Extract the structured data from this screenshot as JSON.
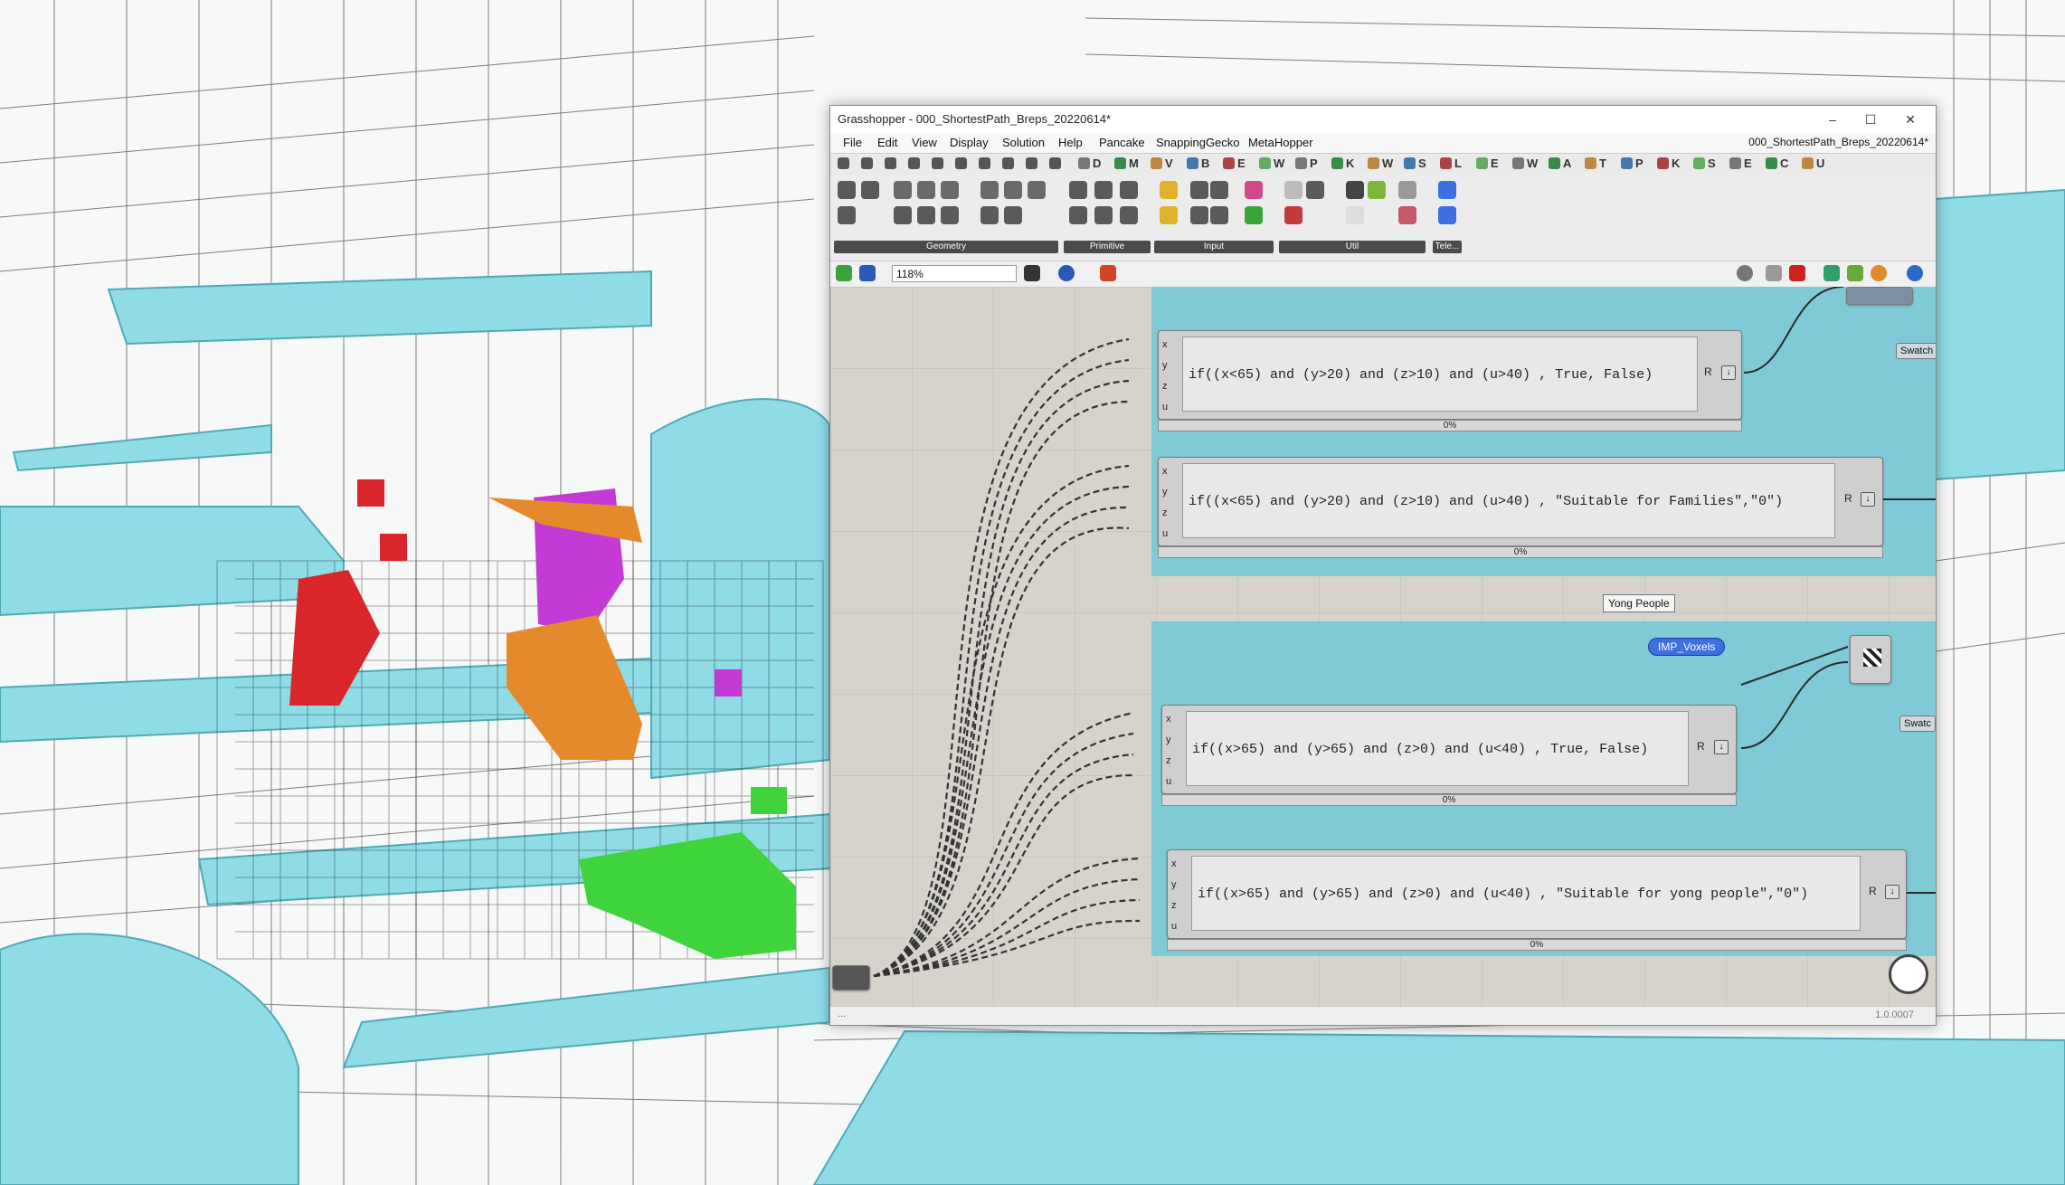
{
  "window": {
    "title": "Grasshopper - 000_ShortestPath_Breps_20220614*",
    "doc_name": "000_ShortestPath_Breps_20220614*",
    "controls": [
      "–",
      "☐",
      "✕"
    ]
  },
  "menu": [
    "File",
    "Edit",
    "View",
    "Display",
    "Solution",
    "Help",
    "Pancake",
    "SnappingGecko",
    "MetaHopper"
  ],
  "tabs": [
    "D",
    "M",
    "V",
    "B",
    "E",
    "W",
    "P",
    "K",
    "W",
    "S",
    "L",
    "E",
    "W",
    "A",
    "T",
    "P",
    "K",
    "S",
    "E",
    "C",
    "U"
  ],
  "ribbon_groups": [
    "Geometry",
    "Primitive",
    "Input",
    "Util",
    "Tele..."
  ],
  "toolbar": {
    "zoom": "118%"
  },
  "components": [
    {
      "inputs": [
        "x",
        "y",
        "z",
        "u"
      ],
      "expression": "if((x<65) and (y>20) and (z>10) and (u>40) , True, False)",
      "output": "R",
      "progress": "0%"
    },
    {
      "inputs": [
        "x",
        "y",
        "z",
        "u"
      ],
      "expression": "if((x<65) and (y>20) and (z>10) and (u>40) , \"Suitable for Families\",\"0\")",
      "output": "R",
      "progress": "0%"
    },
    {
      "inputs": [
        "x",
        "y",
        "z",
        "u"
      ],
      "expression": "if((x>65) and (y>65) and (z>0) and (u<40) , True, False)",
      "output": "R",
      "progress": "0%"
    },
    {
      "inputs": [
        "x",
        "y",
        "z",
        "u"
      ],
      "expression": "if((x>65) and (y>65) and (z>0) and (u<40) , \"Suitable for yong people\",\"0\")",
      "output": "R",
      "progress": "0%"
    }
  ],
  "canvas_labels": {
    "group_name": "Yong People",
    "relay": "IMP_Voxels",
    "swatch_1": "Swatch",
    "swatch_2": "Swatc"
  },
  "statusbar": {
    "left": "...",
    "version": "1.0.0007"
  },
  "colors": {
    "group": "#7fcad6",
    "canvas": "#d6d3cc",
    "cyan_geometry": "#8fdce6",
    "red": "#d8262a",
    "magenta": "#c43ad4",
    "orange": "#e48a2c",
    "green": "#3fd43c"
  }
}
